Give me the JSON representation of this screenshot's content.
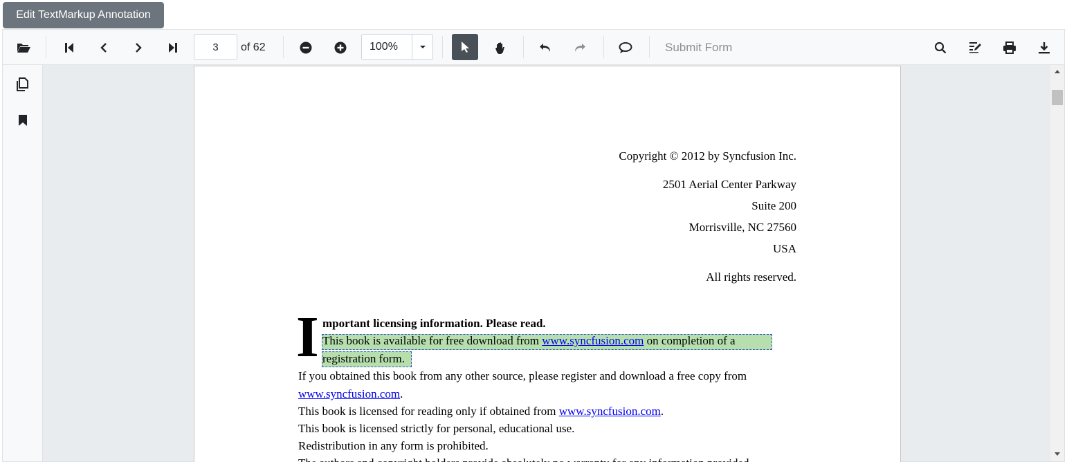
{
  "edit_button": {
    "label": "Edit TextMarkup Annotation"
  },
  "toolbar": {
    "open_icon": "folder-open-icon",
    "first_page_icon": "first-page-icon",
    "prev_page_icon": "previous-page-icon",
    "next_page_icon": "next-page-icon",
    "last_page_icon": "last-page-icon",
    "current_page": "3",
    "total_pages_label": "of 62",
    "zoom_out_icon": "zoom-out-icon",
    "zoom_in_icon": "zoom-in-icon",
    "zoom_value": "100%",
    "select_icon": "text-select-icon",
    "pan_icon": "pan-hand-icon",
    "undo_icon": "undo-icon",
    "redo_icon": "redo-icon",
    "comment_icon": "comment-icon",
    "submit_form_label": "Submit Form",
    "search_icon": "search-icon",
    "annotation_icon": "edit-annotation-icon",
    "print_icon": "print-icon",
    "download_icon": "download-icon"
  },
  "sidebar": {
    "thumbnails_icon": "page-thumbnails-icon",
    "bookmarks_icon": "bookmark-icon"
  },
  "document": {
    "copyright": "Copyright © 2012 by Syncfusion Inc.",
    "address_line1": "2501 Aerial Center Parkway",
    "address_line2": "Suite 200",
    "address_line3": "Morrisville, NC 27560",
    "address_line4": "USA",
    "rights": "All rights reserved.",
    "dropcap": "I",
    "heading": "mportant licensing information. Please read.",
    "para1_start": "This book is available for free download from ",
    "para1_link": "www.syncfusion.com",
    "para1_end": " on completion of a",
    "para1_line2": "registration form.",
    "para2_line1": "If you obtained this book from any other source, please register and download a free copy from",
    "para2_link": "www.syncfusion.com",
    "para2_end": ".",
    "para3_start": "This book is licensed for reading only if obtained from ",
    "para3_link": "www.syncfusion.com",
    "para3_end": ".",
    "para4": "This book is licensed strictly for personal, educational use.",
    "para5": "Redistribution in any form is prohibited.",
    "para6_partial": "The authors and copyright holders provide absolutely no warranty for any information provided."
  },
  "colors": {
    "highlight": "#b7dfae",
    "link": "#0000ee",
    "selected_tool": "#495057"
  }
}
